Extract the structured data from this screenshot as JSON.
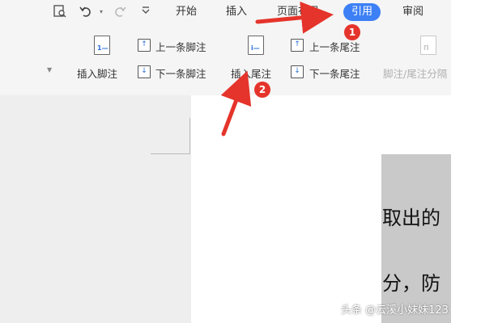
{
  "tabs": {
    "start": "开始",
    "insert": "插入",
    "layout": "页面布局",
    "references": "引用",
    "review": "审阅"
  },
  "ribbon": {
    "insert_footnote": "插入脚注",
    "prev_footnote": "上一条脚注",
    "next_footnote": "下一条脚注",
    "insert_endnote": "插入尾注",
    "prev_endnote": "上一条尾注",
    "next_endnote": "下一条尾注",
    "footnote_endnote_separator": "脚注/尾注分隔"
  },
  "document": {
    "line1": "取出的",
    "line2": "分，防"
  },
  "annotations": {
    "step1": "1",
    "step2": "2",
    "arrow_color": "#e5342b"
  },
  "watermark": "头条 @云溪小妹妹123",
  "colors": {
    "accent": "#3d80f5",
    "ribbon_bg": "#f5f5f5",
    "selection": "#c9c9c9"
  }
}
